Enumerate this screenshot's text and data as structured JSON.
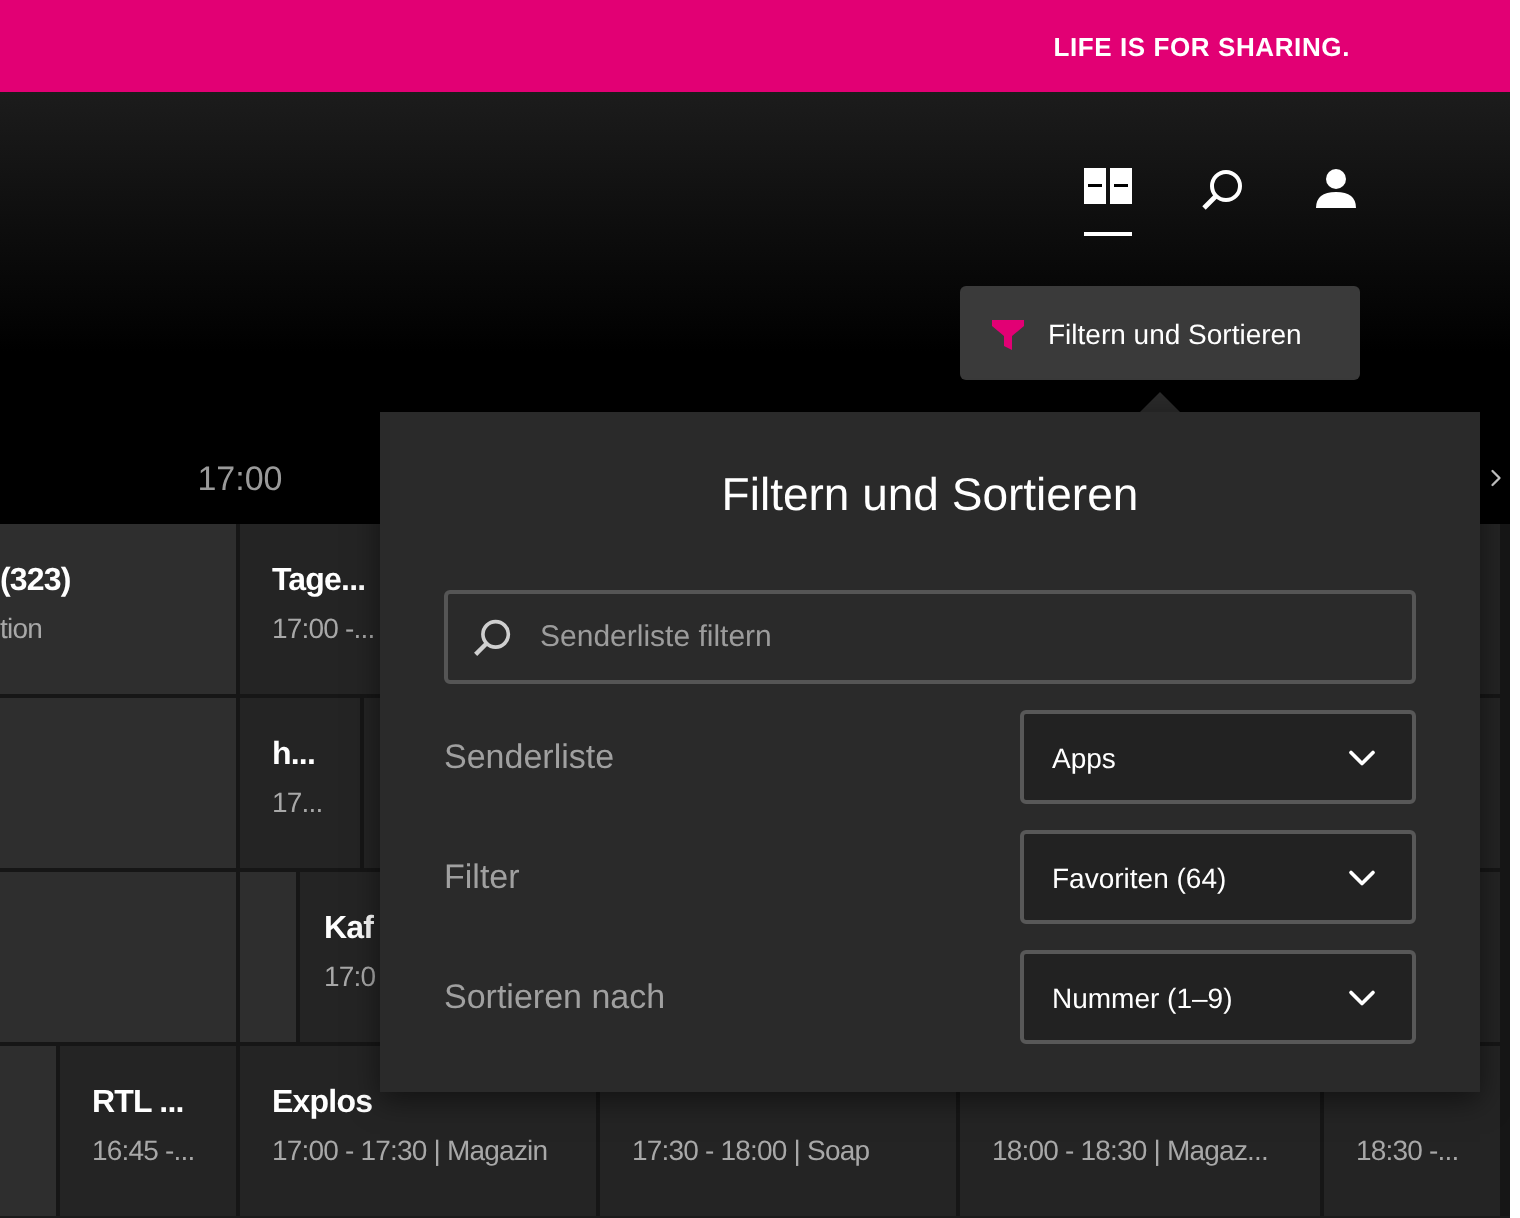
{
  "banner": {
    "slogan": "LIFE IS FOR SHARING."
  },
  "nav": {
    "items": [
      {
        "kind": "tv-guide",
        "selected": true
      },
      {
        "kind": "search",
        "selected": false
      },
      {
        "kind": "account",
        "selected": false
      }
    ]
  },
  "filter_button": {
    "label": "Filtern und Sortieren"
  },
  "timeline": {
    "times": [
      "17:00"
    ]
  },
  "guide": {
    "rows": [
      {
        "cells": [
          {
            "title": "(323)",
            "subtitle": "tion"
          },
          {
            "title": "Tage...",
            "subtitle": "17:00 -..."
          }
        ]
      },
      {
        "cells": [
          {},
          {
            "title": "h...",
            "subtitle": "17..."
          },
          {}
        ]
      },
      {
        "cells": [
          {},
          {},
          {
            "title": "Kaf",
            "subtitle": "17:0"
          }
        ]
      },
      {
        "cells": [
          {},
          {
            "title": "RTL ...",
            "subtitle": "16:45 -..."
          },
          {
            "title": "Explos",
            "subtitle": "17:00 - 17:30 | Magazin"
          },
          {
            "subtitle": "17:30 - 18:00 | Soap"
          },
          {
            "subtitle": "18:00 - 18:30 | Magaz..."
          },
          {
            "subtitle": "18:30 -..."
          }
        ]
      }
    ]
  },
  "panel": {
    "title": "Filtern und Sortieren",
    "search": {
      "placeholder": "Senderliste filtern"
    },
    "fields": [
      {
        "label": "Senderliste",
        "value": "Apps"
      },
      {
        "label": "Filter",
        "value": "Favoriten (64)"
      },
      {
        "label": "Sortieren nach",
        "value": "Nummer (1–9)"
      }
    ]
  }
}
